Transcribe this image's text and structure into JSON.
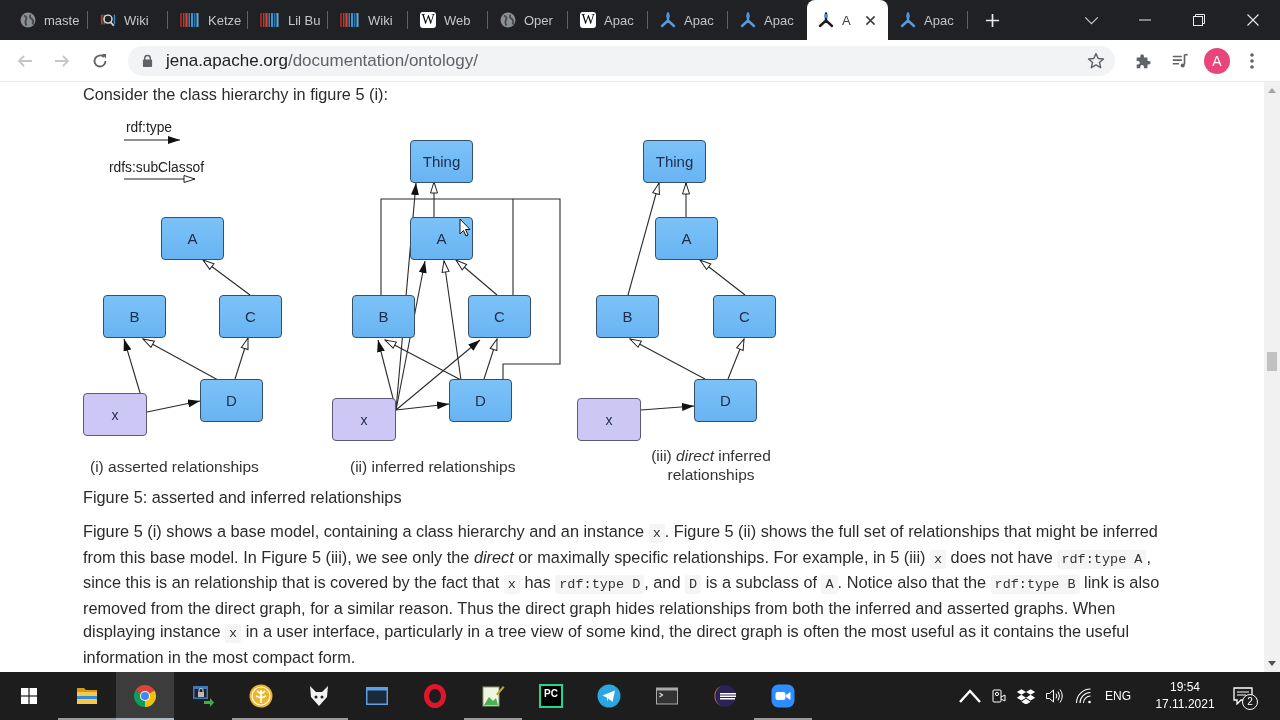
{
  "tabs": [
    {
      "title": "maste",
      "kind": "globe",
      "selected": false
    },
    {
      "title": "Wiki",
      "kind": "magnifier",
      "selected": false
    },
    {
      "title": "Ketze",
      "kind": "stripes",
      "selected": false
    },
    {
      "title": "Lil Bu",
      "kind": "stripes",
      "selected": false
    },
    {
      "title": "Wiki",
      "kind": "stripes",
      "selected": false
    },
    {
      "title": "Web",
      "kind": "letter",
      "letter": "W",
      "selected": false
    },
    {
      "title": "Oper",
      "kind": "globe",
      "selected": false
    },
    {
      "title": "Apac",
      "kind": "letter",
      "letter": "W",
      "selected": false
    },
    {
      "title": "Apac",
      "kind": "tripod",
      "selected": false
    },
    {
      "title": "Apac",
      "kind": "tripod",
      "selected": false
    },
    {
      "title": "A",
      "kind": "tripod",
      "selected": true
    },
    {
      "title": "Apac",
      "kind": "tripod",
      "selected": false
    }
  ],
  "nav_buttons": [
    {
      "kind": "back",
      "disabled": true
    },
    {
      "kind": "forward",
      "disabled": true
    },
    {
      "kind": "reload",
      "disabled": false
    }
  ],
  "address": {
    "host": "jena.apache.org",
    "path": "/documentation/ontology/"
  },
  "profile": {
    "initial": "A"
  },
  "intro": "Consider the class hierarchy in figure 5 (i):",
  "figure": {
    "legend": [
      {
        "label": "rdf:type",
        "kind": "type"
      },
      {
        "label": "rdfs:subClassof",
        "kind": "subclass"
      }
    ],
    "panels": [
      {
        "caption": "(i) asserted relationships",
        "nodes": [
          {
            "label": "A",
            "kind": "class"
          },
          {
            "label": "B",
            "kind": "class"
          },
          {
            "label": "C",
            "kind": "class"
          },
          {
            "label": "D",
            "kind": "class"
          },
          {
            "label": "x",
            "kind": "instance"
          }
        ],
        "edges": [
          {
            "kind": "subclass"
          },
          {
            "kind": "subclass"
          },
          {
            "kind": "subclass"
          },
          {
            "kind": "type"
          },
          {
            "kind": "type"
          }
        ]
      },
      {
        "caption": "(ii) inferred relationships",
        "nodes": [
          {
            "label": "Thing",
            "kind": "class"
          },
          {
            "label": "A",
            "kind": "class"
          },
          {
            "label": "B",
            "kind": "class"
          },
          {
            "label": "C",
            "kind": "class"
          },
          {
            "label": "D",
            "kind": "class"
          },
          {
            "label": "x",
            "kind": "instance"
          }
        ],
        "edges": [
          {
            "kind": "subclass"
          },
          {
            "kind": "type"
          },
          {
            "kind": "subclass"
          },
          {
            "kind": "subclass"
          },
          {
            "kind": "subclass"
          },
          {
            "kind": "subclass"
          },
          {
            "kind": "type"
          },
          {
            "kind": "type"
          },
          {
            "kind": "type"
          },
          {
            "kind": "type"
          }
        ]
      },
      {
        "caption": "(iii) *direct* inferred relationships",
        "nodes": [
          {
            "label": "Thing",
            "kind": "class"
          },
          {
            "label": "A",
            "kind": "class"
          },
          {
            "label": "B",
            "kind": "class"
          },
          {
            "label": "C",
            "kind": "class"
          },
          {
            "label": "D",
            "kind": "class"
          },
          {
            "label": "x",
            "kind": "instance"
          }
        ],
        "edges": [
          {
            "kind": "subclass"
          },
          {
            "kind": "subclass"
          },
          {
            "kind": "subclass"
          },
          {
            "kind": "subclass"
          },
          {
            "kind": "subclass"
          },
          {
            "kind": "type"
          }
        ]
      }
    ]
  },
  "figure_caption": "Figure 5: asserted and inferred relationships",
  "paragraph": [
    {
      "kind": "text",
      "text": "Figure 5 (i) shows a base model, containing a class hierarchy and an instance "
    },
    {
      "kind": "code",
      "text": "x"
    },
    {
      "kind": "text",
      "text": ". Figure 5 (ii) shows the full set of relationships that might be inferred from this base model. In Figure 5 (iii), we see only the *direct* or maximally specific relationships. For example, in 5 (iii) "
    },
    {
      "kind": "code",
      "text": "x"
    },
    {
      "kind": "text",
      "text": " does not have "
    },
    {
      "kind": "code",
      "text": "rdf:type A"
    },
    {
      "kind": "text",
      "text": ", since this is an relationship that is covered by the fact that "
    },
    {
      "kind": "code",
      "text": "x"
    },
    {
      "kind": "text",
      "text": " has "
    },
    {
      "kind": "code",
      "text": "rdf:type D"
    },
    {
      "kind": "text",
      "text": ", and "
    },
    {
      "kind": "code",
      "text": "D"
    },
    {
      "kind": "text",
      "text": " is a subclass of "
    },
    {
      "kind": "code",
      "text": "A"
    },
    {
      "kind": "text",
      "text": ". Notice also that the "
    },
    {
      "kind": "code",
      "text": "rdf:type B"
    },
    {
      "kind": "text",
      "text": " link is also removed from the direct graph, for a similar reason. Thus the direct graph hides relationships from both the inferred and asserted graphs. When displaying instance "
    },
    {
      "kind": "code",
      "text": "x"
    },
    {
      "kind": "text",
      "text": " in a user interface, particularly in a tree view of some kind, the direct graph is often the most useful as it contains the useful information in the most compact form."
    }
  ],
  "taskbar": {
    "apps": [
      {
        "kind": "folder",
        "running": true,
        "selected": false
      },
      {
        "kind": "browser",
        "running": true,
        "selected": true
      },
      {
        "kind": "lock-window",
        "running": false,
        "selected": false
      },
      {
        "kind": "tree-circle",
        "running": true,
        "selected": false
      },
      {
        "kind": "fox",
        "running": true,
        "selected": false
      },
      {
        "kind": "window",
        "running": false,
        "selected": false
      },
      {
        "kind": "ring",
        "running": false,
        "selected": false
      },
      {
        "kind": "picture",
        "running": true,
        "selected": false
      },
      {
        "kind": "letter-tile",
        "tile_text": "PC",
        "running": false,
        "selected": false
      },
      {
        "kind": "plane",
        "running": false,
        "selected": false
      },
      {
        "kind": "terminal",
        "running": false,
        "selected": false
      },
      {
        "kind": "sphere",
        "running": false,
        "selected": false
      },
      {
        "kind": "camera",
        "running": true,
        "selected": false
      }
    ],
    "tray": {
      "language": "ENG",
      "time": "19:54",
      "date": "17.11.2021",
      "notification_count": "2"
    }
  }
}
